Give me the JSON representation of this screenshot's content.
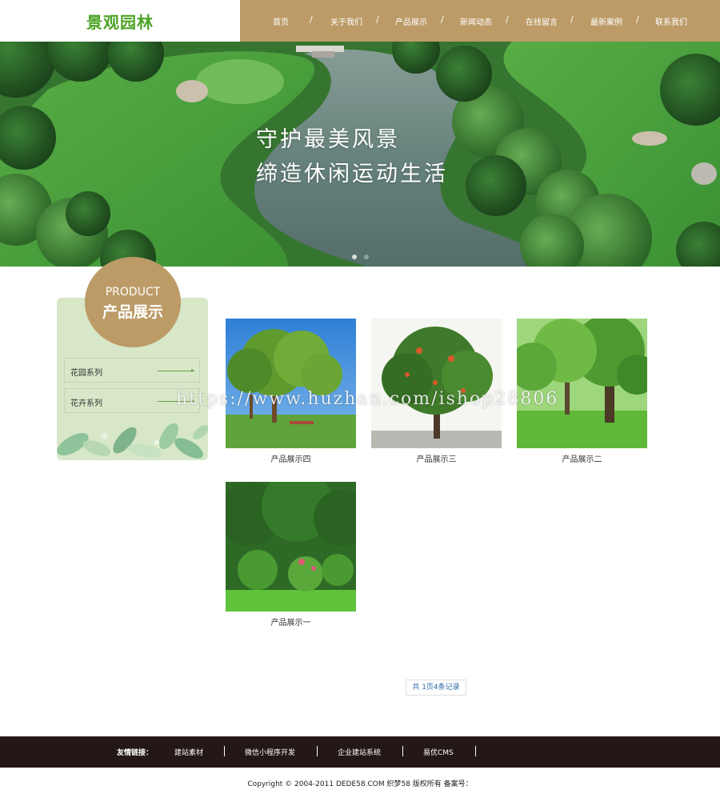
{
  "header": {
    "logo": "景观园林",
    "nav": [
      "首页",
      "关于我们",
      "产品展示",
      "新闻动态",
      "在线留言",
      "最新案例",
      "联系我们"
    ]
  },
  "banner": {
    "line1": "守护最美风景",
    "line2": "缔造休闲运动生活"
  },
  "sidebar": {
    "badge_en": "PRODUCT",
    "badge_cn": "产品展示",
    "items": [
      "花园系列",
      "花卉系列"
    ]
  },
  "products": [
    {
      "caption": "产品展示四"
    },
    {
      "caption": "产品展示三"
    },
    {
      "caption": "产品展示二"
    },
    {
      "caption": "产品展示一"
    }
  ],
  "watermark": "https://www.huzhan.com/ishop28806",
  "pagination": "共 1页4条记录",
  "footer": {
    "links_title": "友情链接：",
    "links": [
      "建站素材",
      "微信小程序开发",
      "企业建站系统",
      "易优CMS"
    ],
    "copyright": "Copyright © 2004-2011 DEDE58.COM 织梦58 版权所有 备案号："
  },
  "colors": {
    "accent": "#bc9b67",
    "logo_green": "#4ca324",
    "sidebar_bg": "#d7e7c8",
    "footer_bg": "#231815"
  }
}
